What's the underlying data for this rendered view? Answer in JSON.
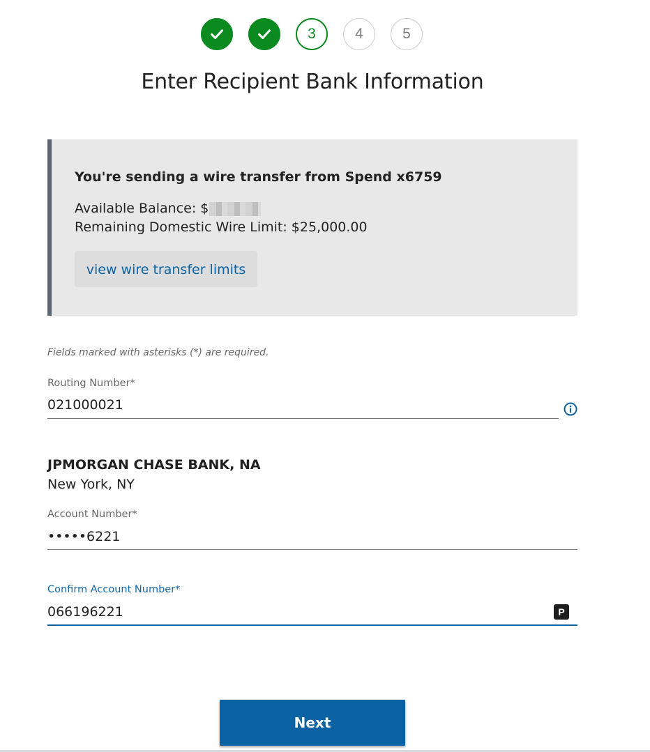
{
  "stepper": {
    "steps": [
      {
        "label": "",
        "state": "done"
      },
      {
        "label": "",
        "state": "done"
      },
      {
        "label": "3",
        "state": "current"
      },
      {
        "label": "4",
        "state": "todo"
      },
      {
        "label": "5",
        "state": "todo"
      }
    ]
  },
  "page": {
    "title": "Enter Recipient Bank Information"
  },
  "info": {
    "from_text": "You're sending a wire transfer from Spend x6759",
    "available_balance_label": "Available Balance: $",
    "domestic_limit_text": "Remaining Domestic Wire Limit: $25,000.00",
    "limits_link": "view wire transfer limits"
  },
  "form": {
    "required_note": "Fields marked with asterisks (*) are required.",
    "routing": {
      "label": "Routing Number*",
      "value": "021000021"
    },
    "bank": {
      "name": "JPMORGAN CHASE BANK, NA",
      "city": "New York, NY"
    },
    "account": {
      "label": "Account Number*",
      "value": "•••••6221"
    },
    "confirm_account": {
      "label": "Confirm Account Number*",
      "value": "066196221",
      "password_manager_badge": "P"
    }
  },
  "actions": {
    "next_label": "Next"
  },
  "colors": {
    "success": "#0a8a1f",
    "primary": "#0c63a3",
    "panel": "#e8e8e8"
  }
}
